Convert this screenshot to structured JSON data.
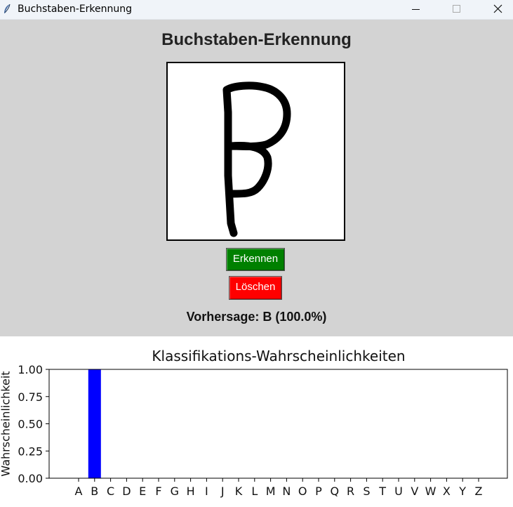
{
  "window": {
    "title": "Buchstaben-Erkennung",
    "icon": "feather-icon",
    "controls": [
      "minimize-icon",
      "maximize-icon",
      "close-icon"
    ]
  },
  "app": {
    "heading": "Buchstaben-Erkennung",
    "recognize_label": "Erkennen",
    "clear_label": "Löschen",
    "prediction_text": "Vorhersage: B (100.0%)",
    "colors": {
      "background": "#d3d3d3",
      "recognize": "#008000",
      "clear": "#ff0000"
    }
  },
  "chart_data": {
    "type": "bar",
    "title": "Klassifikations-Wahrscheinlichkeiten",
    "xlabel": "",
    "ylabel": "Wahrscheinlichkeit",
    "categories": [
      "A",
      "B",
      "C",
      "D",
      "E",
      "F",
      "G",
      "H",
      "I",
      "J",
      "K",
      "L",
      "M",
      "N",
      "O",
      "P",
      "Q",
      "R",
      "S",
      "T",
      "U",
      "V",
      "W",
      "X",
      "Y",
      "Z"
    ],
    "values": [
      0,
      1.0,
      0,
      0,
      0,
      0,
      0,
      0,
      0,
      0,
      0,
      0,
      0,
      0,
      0,
      0,
      0,
      0,
      0,
      0,
      0,
      0,
      0,
      0,
      0,
      0
    ],
    "ylim": [
      0,
      1.0
    ],
    "yticks": [
      "0.00",
      "0.25",
      "0.50",
      "0.75",
      "1.00"
    ],
    "bar_color": "#0000ff",
    "grid": false
  }
}
